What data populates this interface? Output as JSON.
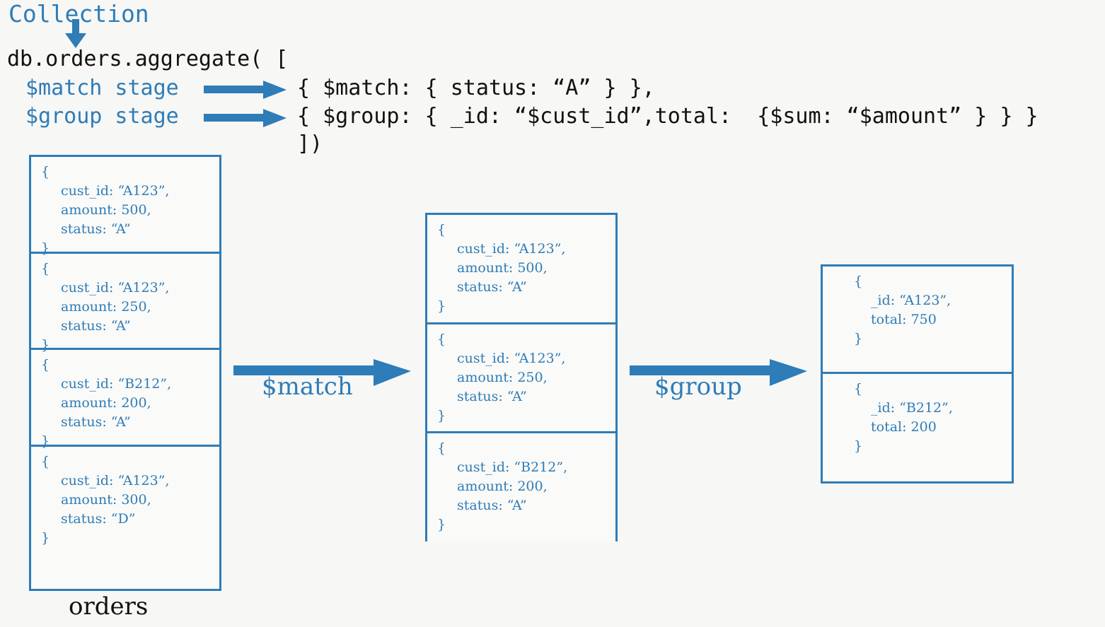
{
  "theme": {
    "background": "#f7f7f5",
    "accent_blue": "#2e7cb8",
    "code_black": "#111111",
    "card_background": "#fafaf8"
  },
  "header": {
    "collection_label": "Collection",
    "down_arrow_icon": "down-arrow-icon"
  },
  "code": {
    "lead_line": "db.orders.aggregate( [",
    "tail_line": "])",
    "stages": [
      {
        "label": "$match stage",
        "arrow_icon": "right-arrow-icon",
        "code": "{ $match: { status: “A” } },"
      },
      {
        "label": "$group stage",
        "arrow_icon": "right-arrow-icon",
        "code": "{ $group: { _id: “$cust_id”,total:  {$sum: “$amount” } } }"
      }
    ]
  },
  "pipeline": {
    "stages": [
      {
        "name": "orders-collection",
        "caption": "orders",
        "documents": [
          {
            "lines": [
              "{",
              "cust_id: “A123”,",
              "amount: 500,",
              "status: “A”",
              "}"
            ]
          },
          {
            "lines": [
              "{",
              "cust_id: “A123”,",
              "amount: 250,",
              "status: “A”",
              "}"
            ]
          },
          {
            "lines": [
              "{",
              "cust_id: “B212”,",
              "amount: 200,",
              "status: “A”",
              "}"
            ]
          },
          {
            "lines": [
              "{",
              "cust_id: “A123”,",
              "amount: 300,",
              "status: “D”",
              "}"
            ]
          }
        ]
      },
      {
        "name": "matched-documents",
        "caption": "",
        "documents": [
          {
            "lines": [
              "{",
              "cust_id: “A123”,",
              "amount: 500,",
              "status: “A”",
              "}"
            ]
          },
          {
            "lines": [
              "{",
              "cust_id: “A123”,",
              "amount: 250,",
              "status: “A”",
              "}"
            ]
          },
          {
            "lines": [
              "{",
              "cust_id: “B212”,",
              "amount: 200,",
              "status: “A”",
              "}"
            ]
          }
        ]
      },
      {
        "name": "grouped-results",
        "caption": "",
        "documents": [
          {
            "lines": [
              "{",
              "_id: “A123”,",
              "total: 750",
              "}"
            ]
          },
          {
            "lines": [
              "{",
              "_id: “B212”,",
              "total: 200",
              "}"
            ]
          }
        ]
      }
    ],
    "transitions": [
      {
        "label": "$match",
        "arrow_icon": "right-arrow-icon"
      },
      {
        "label": "$group",
        "arrow_icon": "right-arrow-icon"
      }
    ]
  }
}
